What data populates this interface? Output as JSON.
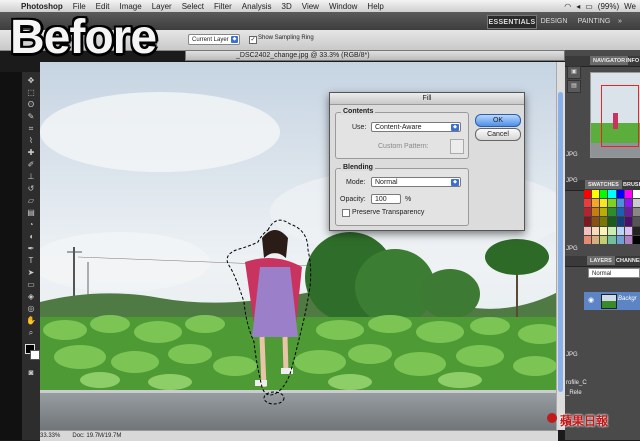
{
  "menubar": {
    "app": "Photoshop",
    "items": [
      "File",
      "Edit",
      "Image",
      "Layer",
      "Select",
      "Filter",
      "Analysis",
      "3D",
      "View",
      "Window",
      "Help"
    ],
    "battery": "(99%)",
    "day": "We"
  },
  "workspaces": {
    "essentials": "ESSENTIALS",
    "design": "DESIGN",
    "painting": "PAINTING",
    "more": "»"
  },
  "options": {
    "sample": "Current Layer",
    "show_sampling_ring": "Show Sampling Ring"
  },
  "overlay": {
    "before": "Before"
  },
  "document": {
    "title": "_DSC2402_change.jpg @ 33.3% (RGB/8*)",
    "zoom": "33.33%",
    "doc_size": "Doc: 19.7M/19.7M"
  },
  "panels": {
    "navigator": "NAVIGATOR",
    "info": "INFO",
    "swatches": "SWATCHES",
    "brushes": "BRUSH",
    "layers": "LAYERS",
    "channels": "CHANNEL",
    "blend_mode": "Normal",
    "layer_name": "Backgr",
    "side_labels": [
      "JPG",
      "JPG",
      "JPG",
      "JPG"
    ],
    "file_labels": [
      "rofile_C",
      "_Rele"
    ]
  },
  "dialog": {
    "title": "Fill",
    "contents_title": "Contents",
    "use_label": "Use:",
    "use_value": "Content-Aware",
    "pattern_label": "Custom Pattern:",
    "blending_title": "Blending",
    "mode_label": "Mode:",
    "mode_value": "Normal",
    "opacity_label": "Opacity:",
    "opacity_value": "100",
    "opacity_unit": "%",
    "preserve_label": "Preserve Transparency",
    "ok": "OK",
    "cancel": "Cancel"
  },
  "watermark": {
    "text": "蘋果日報"
  },
  "colors": {
    "sky": "#dfe6ec",
    "foliage": "#5cae3c",
    "dress": "#c83a6a",
    "accent_blue": "#3b6fd0"
  }
}
